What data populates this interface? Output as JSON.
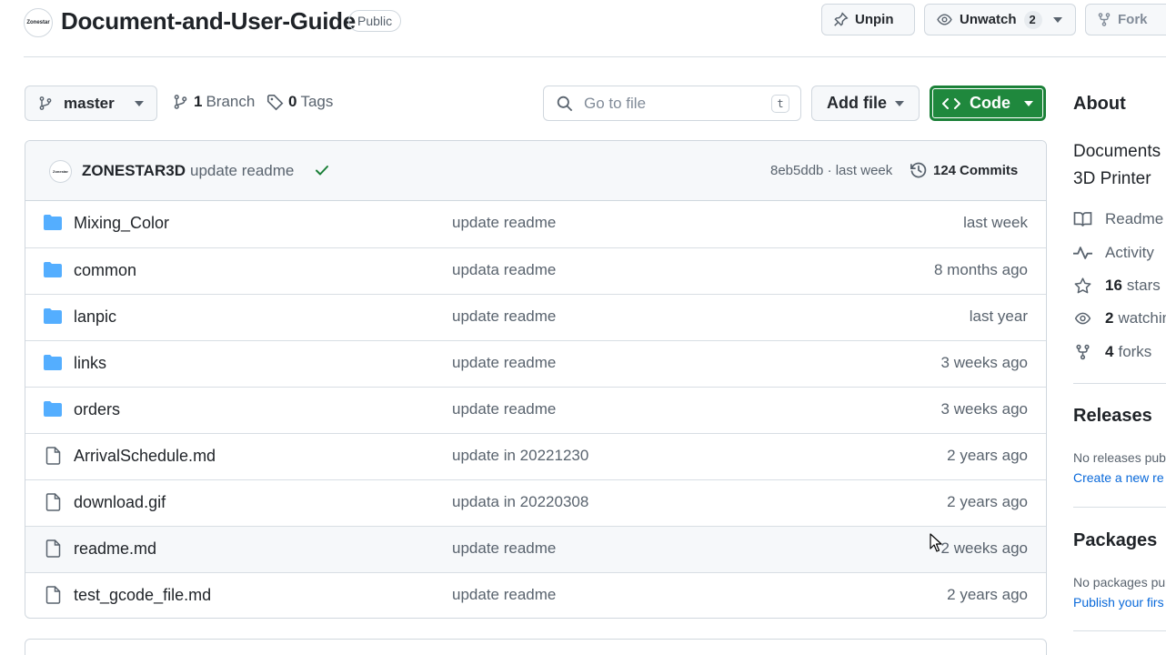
{
  "repo": {
    "name": "Document-and-User-Guide",
    "visibility": "Public",
    "owner_logo_text": "Zonestar"
  },
  "header_actions": {
    "unpin_label": "Unpin",
    "watch_label": "Unwatch",
    "watch_count": "2",
    "fork_label": "Fork"
  },
  "toolbar": {
    "branch": "master",
    "branches_count": "1",
    "branches_label": "Branch",
    "tags_count": "0",
    "tags_label": "Tags",
    "goto_placeholder": "Go to file",
    "goto_shortcut": "t",
    "add_file_label": "Add file",
    "code_label": "Code"
  },
  "latest_commit": {
    "author": "ZONESTAR3D",
    "message": "update readme",
    "meta": "8eb5ddb · last week",
    "commits_count": "124",
    "commits_label": "Commits"
  },
  "files": [
    {
      "type": "folder",
      "name": "Mixing_Color",
      "message": "update readme",
      "date": "last week"
    },
    {
      "type": "folder",
      "name": "common",
      "message": "updata readme",
      "date": "8 months ago"
    },
    {
      "type": "folder",
      "name": "lanpic",
      "message": "update readme",
      "date": "last year"
    },
    {
      "type": "folder",
      "name": "links",
      "message": "update readme",
      "date": "3 weeks ago"
    },
    {
      "type": "folder",
      "name": "orders",
      "message": "update readme",
      "date": "3 weeks ago"
    },
    {
      "type": "file",
      "name": "ArrivalSchedule.md",
      "message": "update in 20221230",
      "date": "2 years ago"
    },
    {
      "type": "file",
      "name": "download.gif",
      "message": "updata in 20220308",
      "date": "2 years ago"
    },
    {
      "type": "file",
      "name": "readme.md",
      "message": "update readme",
      "date": "2 weeks ago"
    },
    {
      "type": "file",
      "name": "test_gcode_file.md",
      "message": "update readme",
      "date": "2 years ago"
    }
  ],
  "sidebar": {
    "about_heading": "About",
    "description_line1": "Documents",
    "description_line2": "3D Printer",
    "readme_label": "Readme",
    "activity_label": "Activity",
    "stars_count": "16",
    "stars_label": "stars",
    "watching_count": "2",
    "watching_label": "watchin",
    "forks_count": "4",
    "forks_label": "forks",
    "releases_heading": "Releases",
    "releases_text": "No releases pub",
    "releases_link": "Create a new re",
    "packages_heading": "Packages",
    "packages_text": "No packages pu",
    "packages_link": "Publish your firs"
  },
  "colors": {
    "accent_green": "#1f883d",
    "folder_blue": "#54aeff",
    "link_blue": "#0969da",
    "check_green": "#1a7f37"
  }
}
